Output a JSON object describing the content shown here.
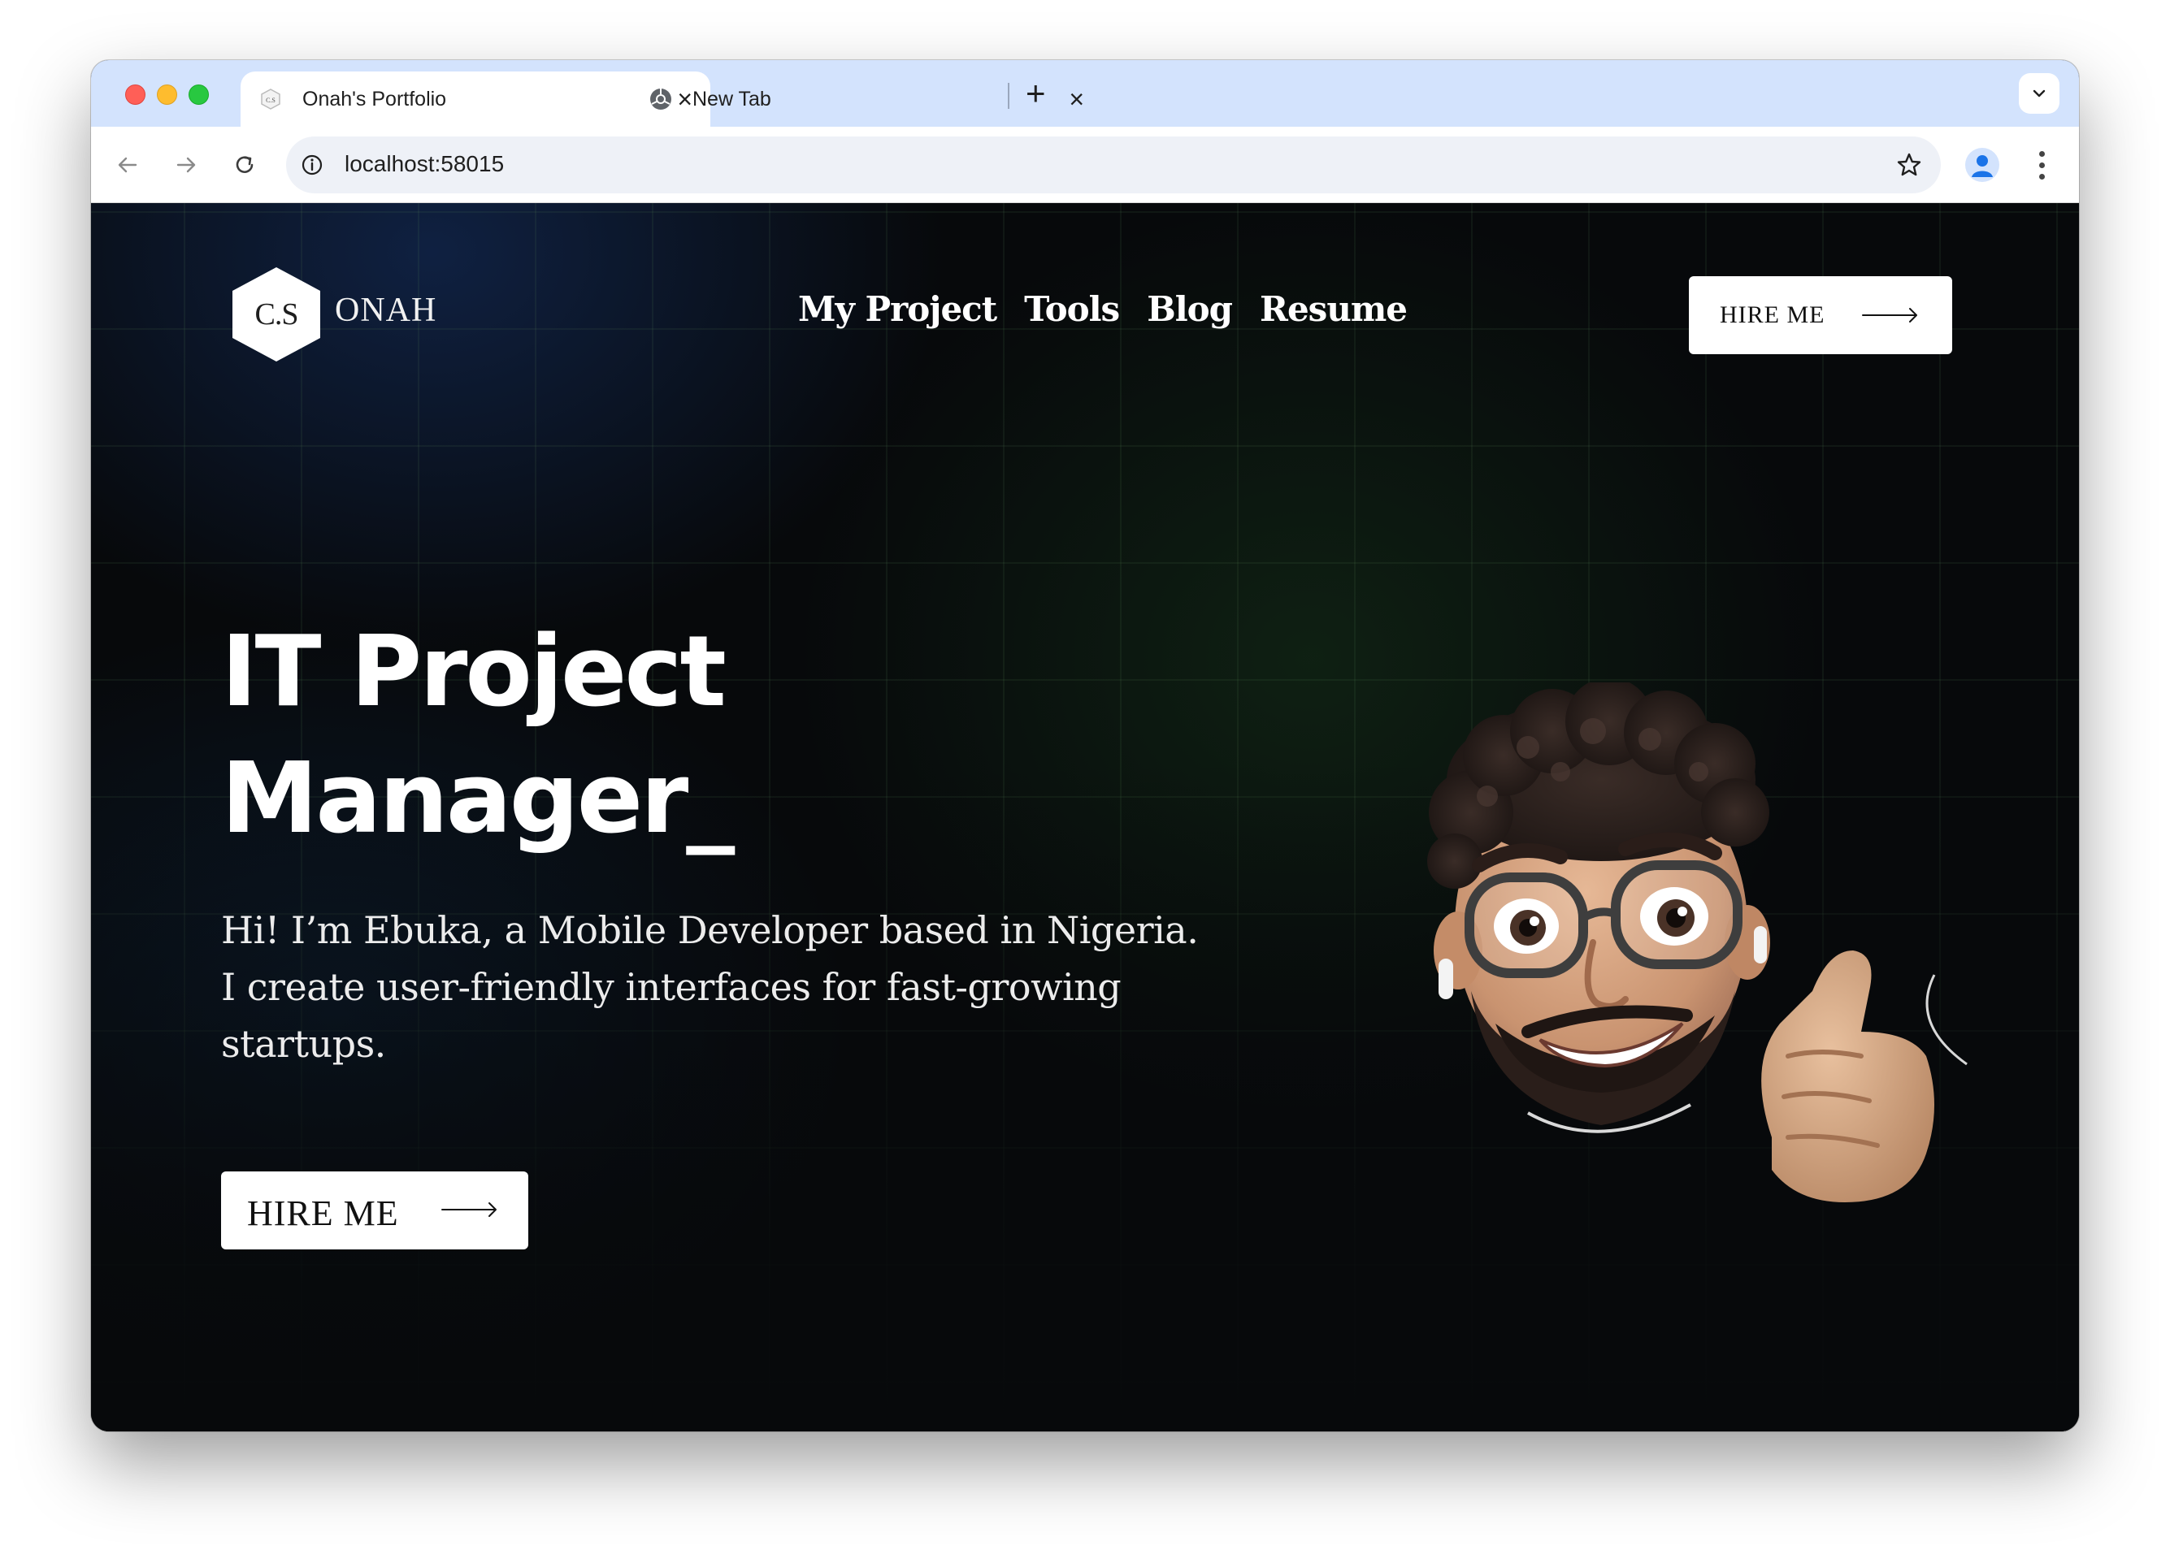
{
  "browser": {
    "tabs": [
      {
        "title": "Onah's Portfolio",
        "active": true
      },
      {
        "title": "New Tab",
        "active": false
      }
    ],
    "url": "localhost:58015"
  },
  "site": {
    "logo_text": "C.S",
    "brand_name": "ONAH",
    "nav": [
      "My Project",
      "Tools",
      "Blog",
      "Resume"
    ],
    "hire_top_label": "HIRE ME"
  },
  "hero": {
    "headline_line1": "IT Project",
    "headline_line2": "Manager_",
    "intro": "Hi! I’m Ebuka, a Mobile Developer based in Nigeria. I create user-friendly interfaces for fast-growing startups.",
    "hire_label": "HIRE ME"
  },
  "icons": {
    "tab_favicon": "hexagon-logo-icon",
    "new_tab_favicon": "chrome-icon",
    "avatar": "memoji-thumbs-up"
  },
  "colors": {
    "tabstrip": "#d3e3fd",
    "page_background": "#07090b",
    "accent_white": "#ffffff"
  }
}
